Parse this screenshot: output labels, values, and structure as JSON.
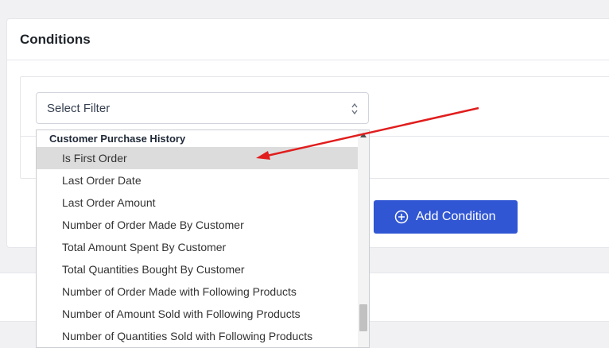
{
  "conditions_card": {
    "title": "Conditions"
  },
  "filter_select": {
    "value": "Select Filter"
  },
  "add_condition_button": {
    "label": "Add Condition",
    "icon": "plus-circle-icon"
  },
  "dropdown": {
    "group_label": "Customer Purchase History",
    "highlighted_index": 0,
    "items": [
      "Is First Order",
      "Last Order Date",
      "Last Order Amount",
      "Number of Order Made By Customer",
      "Total Amount Spent By Customer",
      "Total Quantities Bought By Customer",
      "Number of Order Made with Following Products",
      "Number of Amount Sold with Following Products",
      "Number of Quantities Sold with Following Products"
    ]
  },
  "annotation": {
    "arrow_color": "#e11d1d"
  },
  "colors": {
    "accent": "#3056d3",
    "highlight": "#dcdcdc"
  }
}
